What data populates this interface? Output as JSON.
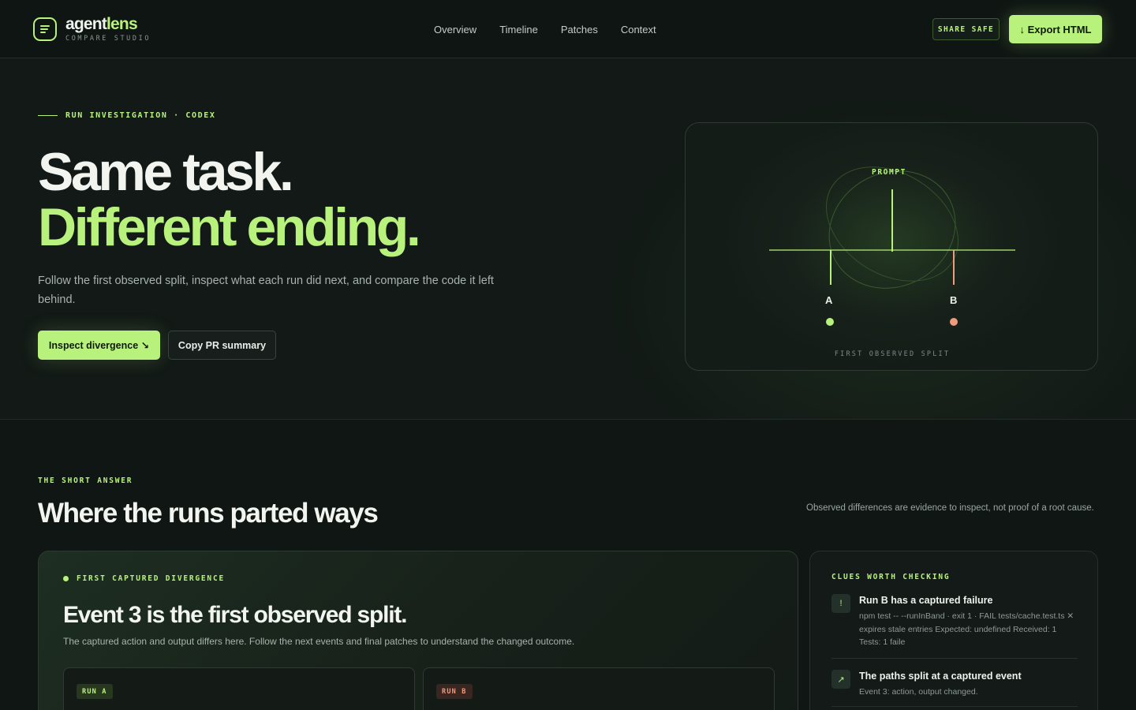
{
  "brand": {
    "name_part1": "agent",
    "name_part2": "lens",
    "subtitle": "COMPARE STUDIO",
    "logo_icon": "document-icon",
    "accent_color": "#b8f27c"
  },
  "nav": {
    "items": [
      "Overview",
      "Timeline",
      "Patches",
      "Context"
    ]
  },
  "header_actions": {
    "share_label": "SHARE SAFE",
    "export_label": "↓ Export HTML"
  },
  "hero": {
    "kicker": "RUN INVESTIGATION · CODEX",
    "title_line1": "Same task.",
    "title_line2": "Different ending.",
    "lead": "Follow the first observed split, inspect what each run did next, and compare the code it left behind.",
    "primary_button": "Inspect divergence ↘",
    "secondary_button": "Copy PR summary"
  },
  "diagram": {
    "prompt_label": "PROMPT",
    "run_a_label": "A",
    "run_b_label": "B",
    "caption": "FIRST OBSERVED SPLIT",
    "run_a_color": "#b8f27c",
    "run_b_color": "#f19a7d"
  },
  "short_answer": {
    "kicker": "THE SHORT ANSWER",
    "title": "Where the runs parted ways",
    "note": "Observed differences are evidence to inspect, not proof of a root cause."
  },
  "divergence": {
    "kicker": "FIRST CAPTURED DIVERGENCE",
    "title": "Event 3 is the first observed split.",
    "description": "The captured action and output differs here. Follow the next events and final patches to understand the changed outcome.",
    "run_a_badge": "RUN A",
    "run_b_badge": "RUN B"
  },
  "clues": {
    "kicker": "CLUES WORTH CHECKING",
    "items": [
      {
        "icon": "!",
        "icon_name": "alert-icon",
        "title": "Run B has a captured failure",
        "body": "npm test -- --runInBand · exit 1 · FAIL tests/cache.test.ts ✕ expires stale entries Expected: undefined Received: 1 Tests: 1 faile"
      },
      {
        "icon": "↗",
        "icon_name": "arrow-up-right-icon",
        "title": "The paths split at a captured event",
        "body": "Event 3: action, output changed."
      }
    ]
  }
}
